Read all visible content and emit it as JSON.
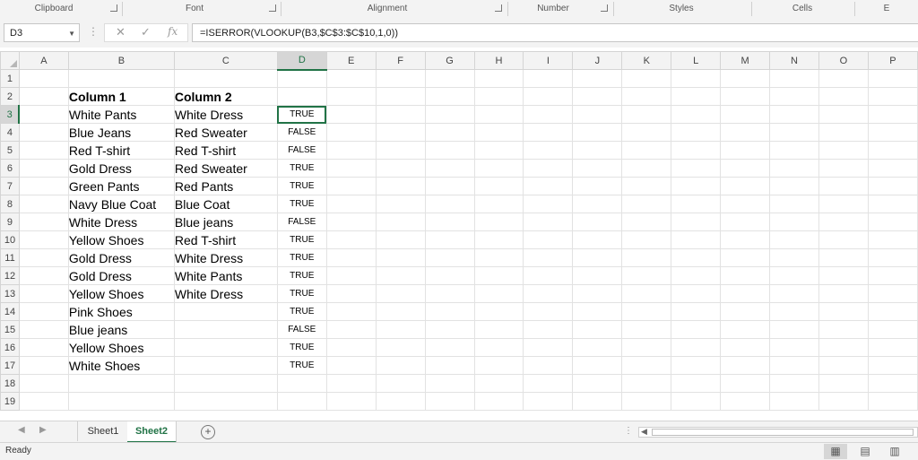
{
  "ribbon": {
    "groups": [
      "Clipboard",
      "Font",
      "Alignment",
      "Number",
      "Styles",
      "Cells",
      "E"
    ]
  },
  "formula_bar": {
    "name_box": "D3",
    "formula": "=ISERROR(VLOOKUP(B3,$C$3:$C$10,1,0))",
    "cancel_icon": "close-icon",
    "enter_icon": "check-icon",
    "function_label": "fx"
  },
  "grid": {
    "columns": [
      "A",
      "B",
      "C",
      "D",
      "E",
      "F",
      "G",
      "H",
      "I",
      "J",
      "K",
      "L",
      "M",
      "N",
      "O",
      "P"
    ],
    "selected_column": "D",
    "selected_row": 3,
    "rows": [
      {
        "n": "1",
        "b": "",
        "c": "",
        "d": ""
      },
      {
        "n": "2",
        "b": "Column 1",
        "c": "Column 2",
        "d": ""
      },
      {
        "n": "3",
        "b": "White Pants",
        "c": "White Dress",
        "d": "TRUE"
      },
      {
        "n": "4",
        "b": "Blue Jeans",
        "c": "Red Sweater",
        "d": "FALSE"
      },
      {
        "n": "5",
        "b": "Red T-shirt",
        "c": "Red T-shirt",
        "d": "FALSE"
      },
      {
        "n": "6",
        "b": "Gold Dress",
        "c": "Red Sweater",
        "d": "TRUE"
      },
      {
        "n": "7",
        "b": "Green Pants",
        "c": "Red Pants",
        "d": "TRUE"
      },
      {
        "n": "8",
        "b": "Navy Blue Coat",
        "c": "Blue Coat",
        "d": "TRUE"
      },
      {
        "n": "9",
        "b": "White Dress",
        "c": "Blue jeans",
        "d": "FALSE"
      },
      {
        "n": "10",
        "b": "Yellow Shoes",
        "c": "Red T-shirt",
        "d": "TRUE"
      },
      {
        "n": "11",
        "b": "Gold Dress",
        "c": "White Dress",
        "d": "TRUE"
      },
      {
        "n": "12",
        "b": "Gold Dress",
        "c": "White Pants",
        "d": "TRUE"
      },
      {
        "n": "13",
        "b": "Yellow Shoes",
        "c": "White Dress",
        "d": "TRUE"
      },
      {
        "n": "14",
        "b": "Pink Shoes",
        "c": "",
        "d": "TRUE"
      },
      {
        "n": "15",
        "b": "Blue jeans",
        "c": "",
        "d": "FALSE"
      },
      {
        "n": "16",
        "b": "Yellow Shoes",
        "c": "",
        "d": "TRUE"
      },
      {
        "n": "17",
        "b": "White Shoes",
        "c": "",
        "d": "TRUE"
      },
      {
        "n": "18",
        "b": "",
        "c": "",
        "d": ""
      },
      {
        "n": "19",
        "b": "",
        "c": "",
        "d": ""
      }
    ]
  },
  "sheet_tabs": {
    "tabs": [
      "Sheet1",
      "Sheet2"
    ],
    "active": "Sheet2",
    "add_label": "+"
  },
  "status_bar": {
    "status": "Ready"
  },
  "colors": {
    "accent": "#217346",
    "chrome": "#f3f3f3",
    "gridline": "#e2e2e2"
  }
}
